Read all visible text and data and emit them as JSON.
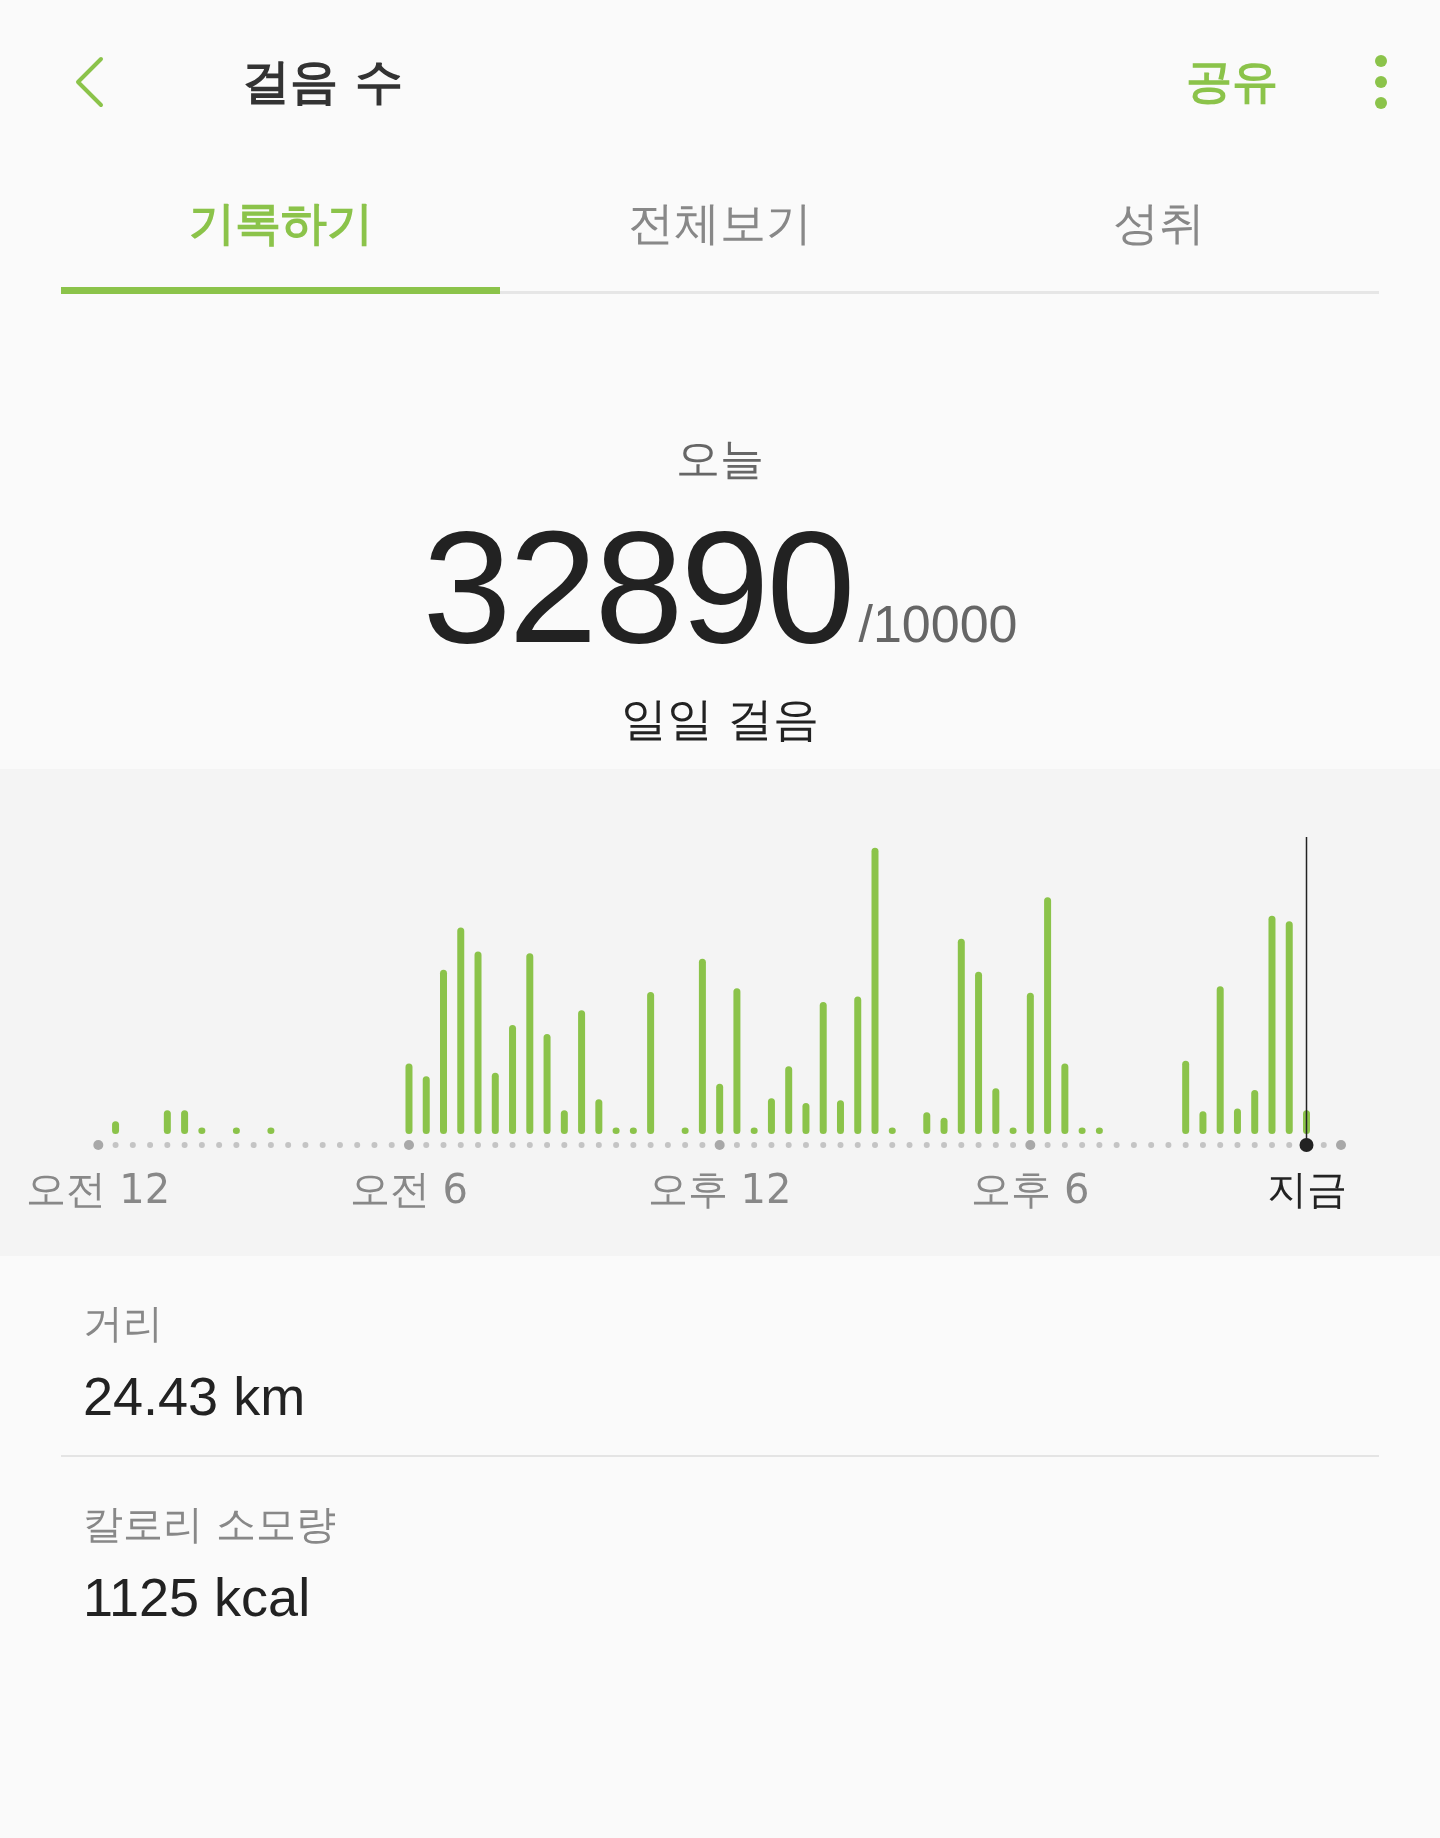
{
  "header": {
    "title": "걸음 수",
    "share": "공유"
  },
  "tabs": [
    {
      "label": "기록하기",
      "selected": true
    },
    {
      "label": "전체보기",
      "selected": false
    },
    {
      "label": "성취",
      "selected": false
    }
  ],
  "summary": {
    "period": "오늘",
    "steps": "32890",
    "goal": "/10000",
    "caption": "일일 걸음"
  },
  "timeline": {
    "labels": [
      "오전 12",
      "오전 6",
      "오후 12",
      "오후 6"
    ],
    "now_label": "지금"
  },
  "stats": [
    {
      "label": "거리",
      "value": "24.43 km"
    },
    {
      "label": "칼로리 소모량",
      "value": "1125 kcal"
    }
  ]
}
